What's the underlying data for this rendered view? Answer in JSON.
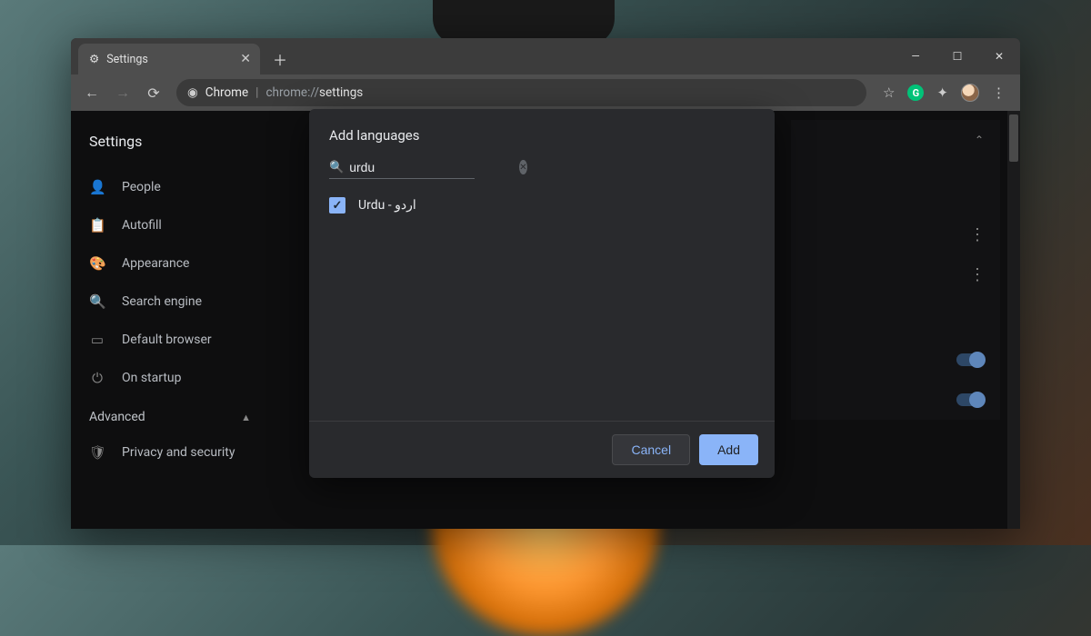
{
  "tab": {
    "title": "Settings"
  },
  "omnibox": {
    "pill": "Chrome",
    "path_dim": "chrome://",
    "path_light": "settings"
  },
  "sidebar": {
    "title": "Settings",
    "items": [
      {
        "label": "People"
      },
      {
        "label": "Autofill"
      },
      {
        "label": "Appearance"
      },
      {
        "label": "Search engine"
      },
      {
        "label": "Default browser"
      },
      {
        "label": "On startup"
      }
    ],
    "advanced": "Advanced",
    "adv_items": [
      {
        "label": "Privacy and security"
      }
    ]
  },
  "dialog": {
    "title": "Add languages",
    "search_value": "urdu",
    "result_label": "Urdu - اردو",
    "cancel": "Cancel",
    "add": "Add"
  }
}
